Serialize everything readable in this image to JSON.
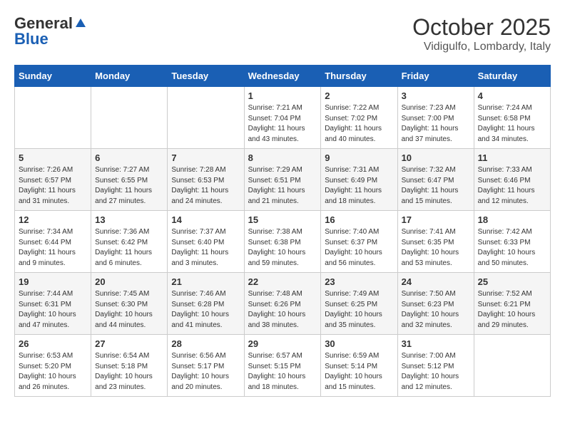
{
  "header": {
    "logo_general": "General",
    "logo_blue": "Blue",
    "title": "October 2025",
    "location": "Vidigulfo, Lombardy, Italy"
  },
  "weekdays": [
    "Sunday",
    "Monday",
    "Tuesday",
    "Wednesday",
    "Thursday",
    "Friday",
    "Saturday"
  ],
  "weeks": [
    [
      {
        "day": "",
        "info": ""
      },
      {
        "day": "",
        "info": ""
      },
      {
        "day": "",
        "info": ""
      },
      {
        "day": "1",
        "info": "Sunrise: 7:21 AM\nSunset: 7:04 PM\nDaylight: 11 hours\nand 43 minutes."
      },
      {
        "day": "2",
        "info": "Sunrise: 7:22 AM\nSunset: 7:02 PM\nDaylight: 11 hours\nand 40 minutes."
      },
      {
        "day": "3",
        "info": "Sunrise: 7:23 AM\nSunset: 7:00 PM\nDaylight: 11 hours\nand 37 minutes."
      },
      {
        "day": "4",
        "info": "Sunrise: 7:24 AM\nSunset: 6:58 PM\nDaylight: 11 hours\nand 34 minutes."
      }
    ],
    [
      {
        "day": "5",
        "info": "Sunrise: 7:26 AM\nSunset: 6:57 PM\nDaylight: 11 hours\nand 31 minutes."
      },
      {
        "day": "6",
        "info": "Sunrise: 7:27 AM\nSunset: 6:55 PM\nDaylight: 11 hours\nand 27 minutes."
      },
      {
        "day": "7",
        "info": "Sunrise: 7:28 AM\nSunset: 6:53 PM\nDaylight: 11 hours\nand 24 minutes."
      },
      {
        "day": "8",
        "info": "Sunrise: 7:29 AM\nSunset: 6:51 PM\nDaylight: 11 hours\nand 21 minutes."
      },
      {
        "day": "9",
        "info": "Sunrise: 7:31 AM\nSunset: 6:49 PM\nDaylight: 11 hours\nand 18 minutes."
      },
      {
        "day": "10",
        "info": "Sunrise: 7:32 AM\nSunset: 6:47 PM\nDaylight: 11 hours\nand 15 minutes."
      },
      {
        "day": "11",
        "info": "Sunrise: 7:33 AM\nSunset: 6:46 PM\nDaylight: 11 hours\nand 12 minutes."
      }
    ],
    [
      {
        "day": "12",
        "info": "Sunrise: 7:34 AM\nSunset: 6:44 PM\nDaylight: 11 hours\nand 9 minutes."
      },
      {
        "day": "13",
        "info": "Sunrise: 7:36 AM\nSunset: 6:42 PM\nDaylight: 11 hours\nand 6 minutes."
      },
      {
        "day": "14",
        "info": "Sunrise: 7:37 AM\nSunset: 6:40 PM\nDaylight: 11 hours\nand 3 minutes."
      },
      {
        "day": "15",
        "info": "Sunrise: 7:38 AM\nSunset: 6:38 PM\nDaylight: 10 hours\nand 59 minutes."
      },
      {
        "day": "16",
        "info": "Sunrise: 7:40 AM\nSunset: 6:37 PM\nDaylight: 10 hours\nand 56 minutes."
      },
      {
        "day": "17",
        "info": "Sunrise: 7:41 AM\nSunset: 6:35 PM\nDaylight: 10 hours\nand 53 minutes."
      },
      {
        "day": "18",
        "info": "Sunrise: 7:42 AM\nSunset: 6:33 PM\nDaylight: 10 hours\nand 50 minutes."
      }
    ],
    [
      {
        "day": "19",
        "info": "Sunrise: 7:44 AM\nSunset: 6:31 PM\nDaylight: 10 hours\nand 47 minutes."
      },
      {
        "day": "20",
        "info": "Sunrise: 7:45 AM\nSunset: 6:30 PM\nDaylight: 10 hours\nand 44 minutes."
      },
      {
        "day": "21",
        "info": "Sunrise: 7:46 AM\nSunset: 6:28 PM\nDaylight: 10 hours\nand 41 minutes."
      },
      {
        "day": "22",
        "info": "Sunrise: 7:48 AM\nSunset: 6:26 PM\nDaylight: 10 hours\nand 38 minutes."
      },
      {
        "day": "23",
        "info": "Sunrise: 7:49 AM\nSunset: 6:25 PM\nDaylight: 10 hours\nand 35 minutes."
      },
      {
        "day": "24",
        "info": "Sunrise: 7:50 AM\nSunset: 6:23 PM\nDaylight: 10 hours\nand 32 minutes."
      },
      {
        "day": "25",
        "info": "Sunrise: 7:52 AM\nSunset: 6:21 PM\nDaylight: 10 hours\nand 29 minutes."
      }
    ],
    [
      {
        "day": "26",
        "info": "Sunrise: 6:53 AM\nSunset: 5:20 PM\nDaylight: 10 hours\nand 26 minutes."
      },
      {
        "day": "27",
        "info": "Sunrise: 6:54 AM\nSunset: 5:18 PM\nDaylight: 10 hours\nand 23 minutes."
      },
      {
        "day": "28",
        "info": "Sunrise: 6:56 AM\nSunset: 5:17 PM\nDaylight: 10 hours\nand 20 minutes."
      },
      {
        "day": "29",
        "info": "Sunrise: 6:57 AM\nSunset: 5:15 PM\nDaylight: 10 hours\nand 18 minutes."
      },
      {
        "day": "30",
        "info": "Sunrise: 6:59 AM\nSunset: 5:14 PM\nDaylight: 10 hours\nand 15 minutes."
      },
      {
        "day": "31",
        "info": "Sunrise: 7:00 AM\nSunset: 5:12 PM\nDaylight: 10 hours\nand 12 minutes."
      },
      {
        "day": "",
        "info": ""
      }
    ]
  ]
}
